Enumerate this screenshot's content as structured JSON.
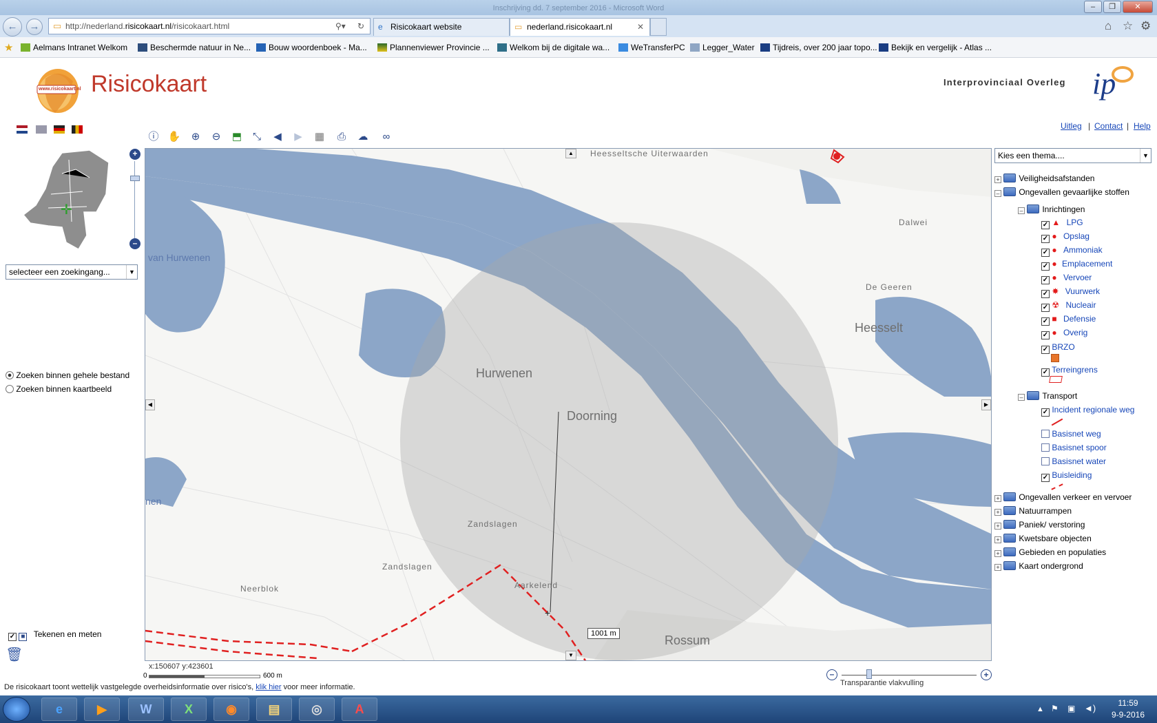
{
  "browser": {
    "window_title": "Inschrijving dd. 7 september 2016 - Microsoft Word",
    "url_prefix": "http://nederland.",
    "url_domain": "risicokaart.nl",
    "url_suffix": "/risicokaart.html",
    "tabs": [
      {
        "label": "Risicokaart website"
      },
      {
        "label": "nederland.risicokaart.nl"
      }
    ],
    "favorites": [
      "Aelmans Intranet  Welkom",
      "Beschermde natuur in Ne...",
      "Bouw woordenboek - Ma...",
      "Plannenviewer Provincie ...",
      "Welkom bij de digitale wa...",
      "WeTransferPC",
      "Legger_Water",
      "Tijdreis, over 200 jaar topo...",
      "Bekijk en vergelijk - Atlas ..."
    ]
  },
  "app": {
    "title": "Risicokaart",
    "logo_text": "www.risicokaart.nl",
    "ipo_text": "Interprovinciaal Overleg",
    "ipo_logo": "ip",
    "links": [
      "Uitleg",
      "Contact",
      "Help"
    ],
    "link_sep": "|"
  },
  "search": {
    "select_value": "selecteer  een zoekingang...",
    "option_whole": "Zoeken binnen gehele bestand",
    "option_view": "Zoeken binnen kaartbeeld",
    "draw_label": "Tekenen en meten"
  },
  "map": {
    "labels": {
      "heesseltsche": "Heesseltsche Uiterwaarden",
      "dalwei": "Dalwei",
      "van_hurwenen": "van Hurwenen",
      "de_geeren": "De Geeren",
      "heesselt": "Heesselt",
      "hurwenen": "Hurwenen",
      "doorning": "Doorning",
      "zandslagen1": "Zandslagen",
      "zandslagen2": "Zandslagen",
      "neerblok": "Neerblok",
      "aarkelend": "Aarkelend",
      "rossum": "Rossum",
      "en": "nen"
    },
    "measure_label": "1001 m",
    "coordinates": "x:150607 y:423601",
    "scale_start": "0",
    "scale_end": "600 m",
    "transparency_label": "Transparantie vlakvulling",
    "theme_select": "Kies een thema...."
  },
  "legend": {
    "groups": [
      {
        "label": "Veiligheidsafstanden",
        "expanded": false
      },
      {
        "label": "Ongevallen gevaarlijke stoffen",
        "expanded": true
      }
    ],
    "inrichtingen": "Inrichtingen",
    "inrichting_items": [
      {
        "label": "LPG",
        "checked": true
      },
      {
        "label": "Opslag",
        "checked": true
      },
      {
        "label": "Ammoniak",
        "checked": true
      },
      {
        "label": "Emplacement",
        "checked": true
      },
      {
        "label": "Vervoer",
        "checked": true
      },
      {
        "label": "Vuurwerk",
        "checked": true
      },
      {
        "label": "Nucleair",
        "checked": true
      },
      {
        "label": "Defensie",
        "checked": true
      },
      {
        "label": "Overig",
        "checked": true
      }
    ],
    "brzo": "BRZO",
    "terreingrens": "Terreingrens",
    "transport": "Transport",
    "transport_items": [
      {
        "label": "Incident regionale weg",
        "checked": true
      },
      {
        "label": "Basisnet weg",
        "checked": false
      },
      {
        "label": "Basisnet spoor",
        "checked": false
      },
      {
        "label": "Basisnet water",
        "checked": false
      },
      {
        "label": "Buisleiding",
        "checked": true
      }
    ],
    "other_groups": [
      "Ongevallen verkeer en vervoer",
      "Natuurrampen",
      "Paniek/ verstoring",
      "Kwetsbare objecten",
      "Gebieden en populaties",
      "Kaart ondergrond"
    ],
    "colors": {
      "marker": "#e31b1b",
      "brzo": "#e8752a",
      "link": "#1646b8",
      "water": "#8ca6c8"
    }
  },
  "footer": {
    "text_before": "De risicokaart toont wettelijk vastgelegde overheidsinformatie over risico's,",
    "link": "klik hier",
    "text_after": "voor meer informatie."
  },
  "taskbar": {
    "time": "11:59",
    "date": "9-9-2016",
    "icons": [
      "start-orb",
      "internet-explorer-icon",
      "media-player-icon",
      "word-icon",
      "excel-icon",
      "firefox-icon",
      "explorer-icon",
      "app-icon",
      "acrobat-icon"
    ]
  }
}
